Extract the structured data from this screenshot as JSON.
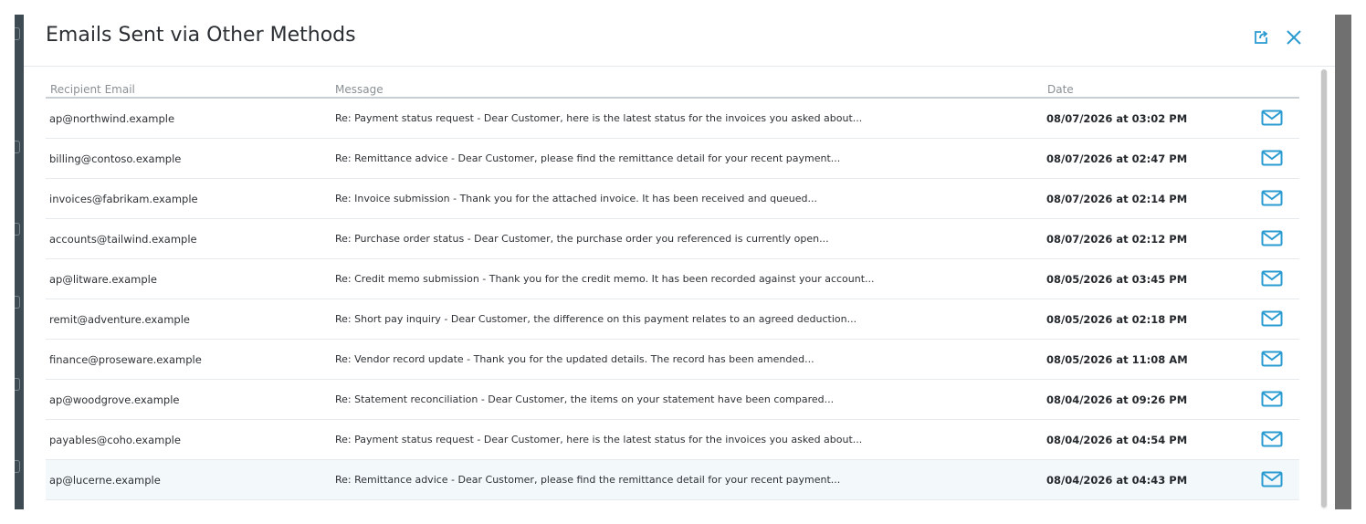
{
  "modal": {
    "title": "Emails Sent via Other Methods",
    "accent_color": "#2a9bd1",
    "export_icon": "export-icon",
    "close_icon": "close-icon"
  },
  "table": {
    "headers": {
      "email": "Recipient Email",
      "message": "Message",
      "date": "Date"
    },
    "action_icon": "mail-icon",
    "rows": [
      {
        "email": "ap@northwind.example",
        "message": "Re: Payment status request - Dear Customer, here is the latest status for the invoices you asked about...",
        "date": "08/07/2026 at 03:02 PM"
      },
      {
        "email": "billing@contoso.example",
        "message": "Re: Remittance advice - Dear Customer, please find the remittance detail for your recent payment...",
        "date": "08/07/2026 at 02:47 PM"
      },
      {
        "email": "invoices@fabrikam.example",
        "message": "Re: Invoice submission - Thank you for the attached invoice. It has been received and queued...",
        "date": "08/07/2026 at 02:14 PM"
      },
      {
        "email": "accounts@tailwind.example",
        "message": "Re: Purchase order status - Dear Customer, the purchase order you referenced is currently open...",
        "date": "08/07/2026 at 02:12 PM"
      },
      {
        "email": "ap@litware.example",
        "message": "Re: Credit memo submission - Thank you for the credit memo. It has been recorded against your account...",
        "date": "08/05/2026 at 03:45 PM"
      },
      {
        "email": "remit@adventure.example",
        "message": "Re: Short pay inquiry - Dear Customer, the difference on this payment relates to an agreed deduction...",
        "date": "08/05/2026 at 02:18 PM"
      },
      {
        "email": "finance@proseware.example",
        "message": "Re: Vendor record update - Thank you for the updated details. The record has been amended...",
        "date": "08/05/2026 at 11:08 AM"
      },
      {
        "email": "ap@woodgrove.example",
        "message": "Re: Statement reconciliation - Dear Customer, the items on your statement have been compared...",
        "date": "08/04/2026 at 09:26 PM"
      },
      {
        "email": "payables@coho.example",
        "message": "Re: Payment status request - Dear Customer, here is the latest status for the invoices you asked about...",
        "date": "08/04/2026 at 04:54 PM"
      },
      {
        "email": "ap@lucerne.example",
        "message": "Re: Remittance advice - Dear Customer, please find the remittance detail for your recent payment...",
        "date": "08/04/2026 at 04:43 PM"
      }
    ]
  }
}
